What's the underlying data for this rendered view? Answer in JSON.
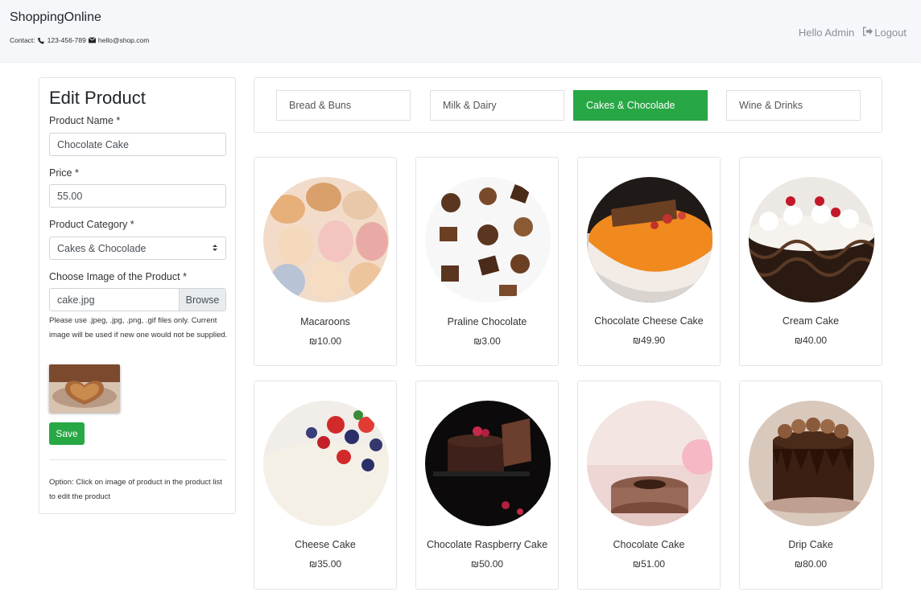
{
  "header": {
    "brand": "ShoppingOnline",
    "contact_label": "Contact:",
    "phone": "123-456-789",
    "email": "hello@shop.com",
    "greeting": "Hello Admin",
    "logout_label": "Logout",
    "phone_icon": "phone-icon",
    "email_icon": "envelope-icon",
    "logout_icon": "sign-out-icon"
  },
  "edit_form": {
    "title": "Edit Product",
    "name_label": "Product Name *",
    "name_value": "Chocolate Cake",
    "price_label": "Price *",
    "price_value": "55.00",
    "category_label": "Product Category *",
    "category_value": "Cakes & Chocolade",
    "image_label": "Choose Image of the Product *",
    "file_name": "cake.jpg",
    "browse_label": "Browse",
    "help_text": "Please use .jpeg, .jpg, .png, .gif files only. Current image will be used if new one would not be supplied.",
    "save_label": "Save",
    "option_text": "Option: Click on image of product in the product list to edit the product"
  },
  "categories": [
    {
      "label": "Bread & Buns",
      "active": false
    },
    {
      "label": "Milk & Dairy",
      "active": false
    },
    {
      "label": "Cakes & Chocolade",
      "active": true
    },
    {
      "label": "Wine & Drinks",
      "active": false
    }
  ],
  "products": [
    {
      "name": "Macaroons",
      "price": "₪10.00"
    },
    {
      "name": "Praline Chocolate",
      "price": "₪3.00"
    },
    {
      "name": "Chocolate Cheese Cake",
      "price": "₪49.90"
    },
    {
      "name": "Cream Cake",
      "price": "₪40.00"
    },
    {
      "name": "Cheese Cake",
      "price": "₪35.00"
    },
    {
      "name": "Chocolate Raspberry Cake",
      "price": "₪50.00"
    },
    {
      "name": "Chocolate Cake",
      "price": "₪51.00"
    },
    {
      "name": "Drip Cake",
      "price": "₪80.00"
    }
  ],
  "colors": {
    "accent": "#28a745",
    "navbar": "#f6f7fb"
  }
}
